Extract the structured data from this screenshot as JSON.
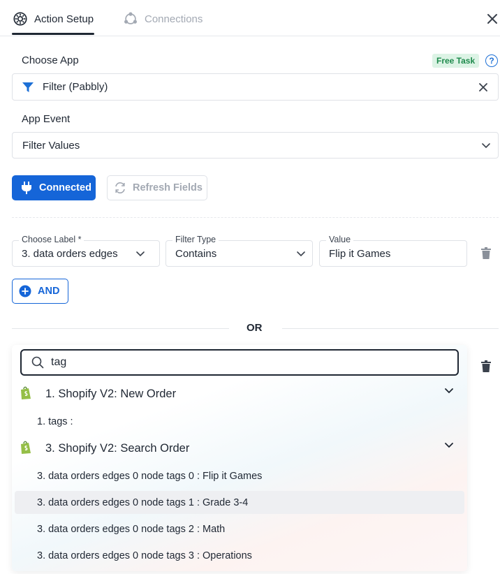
{
  "tabs": {
    "active_label": "Action Setup",
    "inactive_label": "Connections"
  },
  "choose_app": {
    "label": "Choose App",
    "badge": "Free Task",
    "help": "?",
    "value": "Filter (Pabbly)"
  },
  "app_event": {
    "label": "App Event",
    "value": "Filter Values"
  },
  "buttons": {
    "connected": "Connected",
    "refresh": "Refresh Fields",
    "and": "AND"
  },
  "condition": {
    "choose_label_title": "Choose Label *",
    "choose_label_value": "3. data orders edges",
    "filter_type_title": "Filter Type",
    "filter_type_value": "Contains",
    "value_title": "Value",
    "value_value": "Flip it Games"
  },
  "or_label": "OR",
  "dropdown": {
    "search_value": "tag",
    "groups": [
      {
        "label": "1. Shopify V2: New Order",
        "items": [
          "1. tags :"
        ]
      },
      {
        "label": "3. Shopify V2: Search Order",
        "items": [
          "3. data orders edges 0 node tags 0 : Flip it Games",
          "3. data orders edges 0 node tags 1 : Grade 3-4",
          "3. data orders edges 0 node tags 2 : Math",
          "3. data orders edges 0 node tags 3 : Operations"
        ]
      }
    ]
  },
  "colors": {
    "primary": "#1565d8",
    "badge_bg": "#dcf3e5",
    "badge_text": "#1e8a4c",
    "shopify_green": "#95bf47"
  }
}
